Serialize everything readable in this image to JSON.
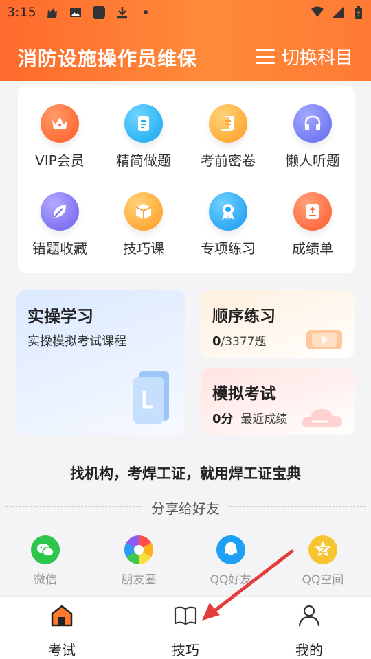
{
  "status": {
    "time": "3:15"
  },
  "header": {
    "title": "消防设施操作员维保",
    "switch_label": "切换科目"
  },
  "grid": [
    {
      "label": "VIP会员",
      "icon": "crown-icon",
      "color": "#ff6e3a"
    },
    {
      "label": "精简做题",
      "icon": "document-icon",
      "color": "#21b3f4"
    },
    {
      "label": "考前密卷",
      "icon": "scroll-icon",
      "color": "#ffa42c"
    },
    {
      "label": "懒人听题",
      "icon": "headphones-icon",
      "color": "#6e76f2"
    },
    {
      "label": "错题收藏",
      "icon": "leaf-icon",
      "color": "#7a6ff0"
    },
    {
      "label": "技巧课",
      "icon": "box-icon",
      "color": "#ffa22a"
    },
    {
      "label": "专项练习",
      "icon": "medal-icon",
      "color": "#1fa9f5"
    },
    {
      "label": "成绩单",
      "icon": "report-icon",
      "color": "#ff6a3a"
    }
  ],
  "cards": {
    "practical": {
      "title": "实操学习",
      "subtitle": "实操模拟考试课程"
    },
    "sequence": {
      "title": "顺序练习",
      "done": "0",
      "total": "/3377题"
    },
    "mock": {
      "title": "模拟考试",
      "score": "0分",
      "note": "最近成绩"
    }
  },
  "slogan": "找机构，考焊工证，就用焊工证宝典",
  "share": {
    "label": "分享给好友",
    "items": [
      {
        "label": "微信",
        "icon": "wechat-icon",
        "color": "#2dc54a"
      },
      {
        "label": "朋友圈",
        "icon": "moments-icon",
        "color": "#ffffff"
      },
      {
        "label": "QQ好友",
        "icon": "qq-icon",
        "color": "#1ea0f5"
      },
      {
        "label": "QQ空间",
        "icon": "qzone-icon",
        "color": "#f7c530"
      }
    ]
  },
  "tabs": [
    {
      "label": "考试",
      "icon": "house-icon"
    },
    {
      "label": "技巧",
      "icon": "book-icon"
    },
    {
      "label": "我的",
      "icon": "person-icon"
    }
  ]
}
